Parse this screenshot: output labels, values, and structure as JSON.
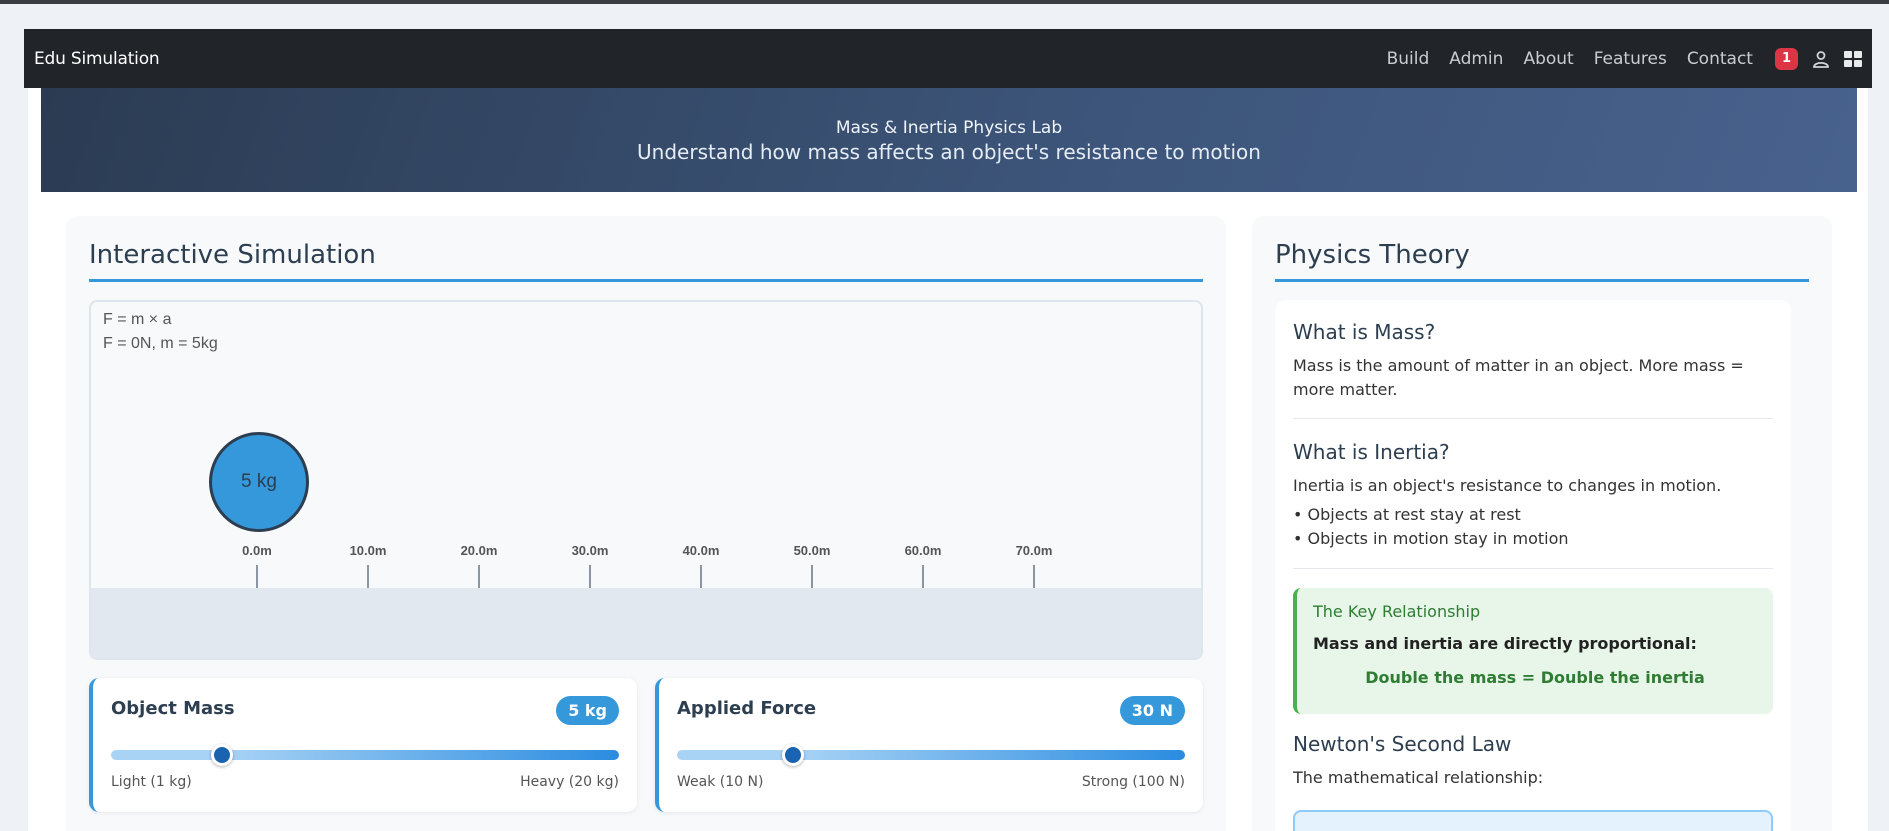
{
  "navbar": {
    "brand": "Edu Simulation",
    "links": [
      "Build",
      "Admin",
      "About",
      "Features",
      "Contact"
    ],
    "notification_count": "1",
    "icons": [
      "user-icon",
      "grid-icon"
    ]
  },
  "hero": {
    "title": "Mass & Inertia Physics Lab",
    "subtitle": "Understand how mass affects an object's resistance to motion"
  },
  "simulation": {
    "heading": "Interactive Simulation",
    "formula_line1": "F = m × a",
    "formula_line2": "F = 0N, m = 5kg",
    "object_label": "5 kg",
    "ruler": [
      "0.0m",
      "10.0m",
      "20.0m",
      "30.0m",
      "40.0m",
      "50.0m",
      "60.0m",
      "70.0m"
    ]
  },
  "controls": {
    "mass": {
      "label": "Object Mass",
      "value": "5 kg",
      "min_label": "Light (1 kg)",
      "max_label": "Heavy (20 kg)",
      "fraction": 0.22
    },
    "force": {
      "label": "Applied Force",
      "value": "30 N",
      "min_label": "Weak (10 N)",
      "max_label": "Strong (100 N)",
      "fraction": 0.23
    }
  },
  "theory": {
    "heading": "Physics Theory",
    "mass_title": "What is Mass?",
    "mass_text": "Mass is the amount of matter in an object. More mass = more matter.",
    "inertia_title": "What is Inertia?",
    "inertia_text": "Inertia is an object's resistance to changes in motion.",
    "bullet1": "• Objects at rest stay at rest",
    "bullet2": "• Objects in motion stay in motion",
    "key_title": "The Key Relationship",
    "key_bold": "Mass and inertia are directly proportional:",
    "key_eq": "Double the mass = Double the inertia",
    "newton_title": "Newton's Second Law",
    "newton_text": "The mathematical relationship:"
  },
  "colors": {
    "accent": "#3498db",
    "navbar": "#212529",
    "badge": "#dc3545",
    "key_green": "#2e7d32"
  }
}
